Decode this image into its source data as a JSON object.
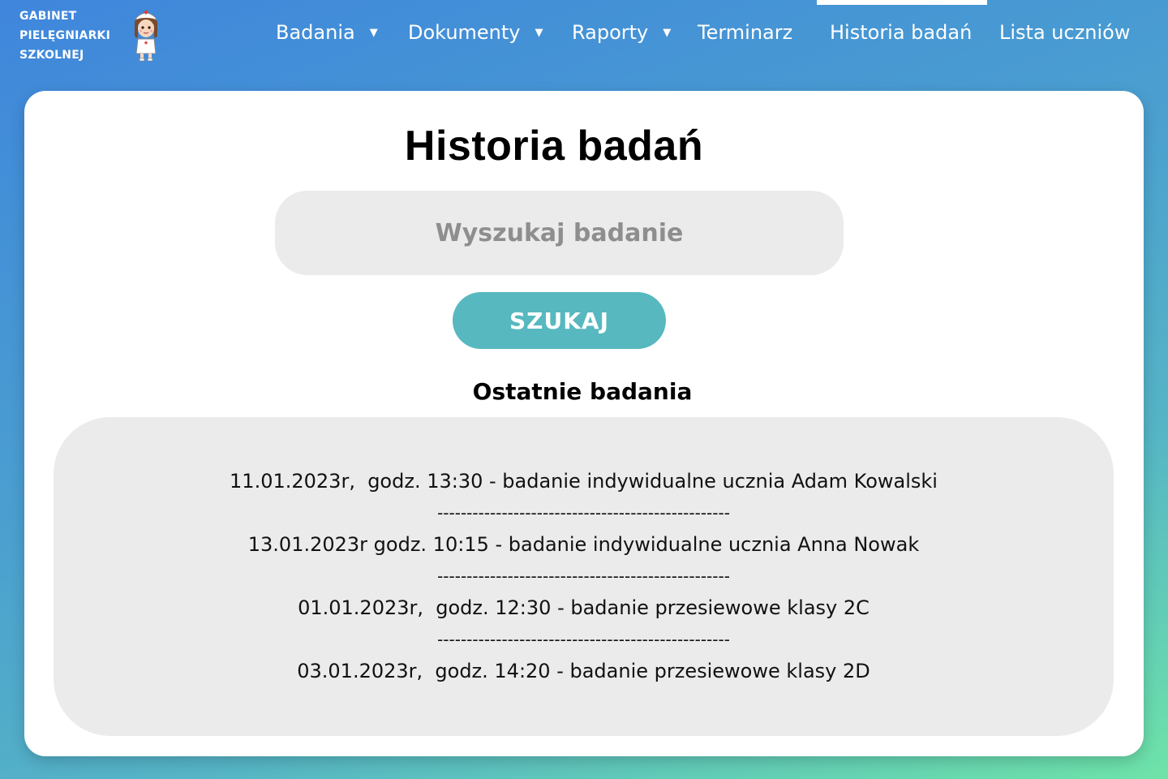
{
  "brand": {
    "lines": [
      "GABINET",
      "PIELĘGNIARKI",
      "SZKOLNEJ"
    ],
    "logo_icon": "nurse-mascot-icon"
  },
  "nav": {
    "items": [
      {
        "label": "Badania",
        "has_dropdown": true
      },
      {
        "label": "Dokumenty",
        "has_dropdown": true
      },
      {
        "label": "Raporty",
        "has_dropdown": true
      },
      {
        "label": "Terminarz",
        "has_dropdown": false
      },
      {
        "label": "Historia badań",
        "has_dropdown": false,
        "active": true
      },
      {
        "label": "Lista uczniów",
        "has_dropdown": false
      }
    ],
    "dropdown_icon": "▼"
  },
  "main": {
    "title": "Historia badań",
    "search": {
      "placeholder": "Wyszukaj badanie",
      "value": ""
    },
    "search_button": "SZUKAJ",
    "recent_title": "Ostatnie badania",
    "recent": [
      "11.01.2023r,  godz. 13:30 - badanie indywidualne ucznia Adam Kowalski",
      "13.01.2023r godz. 10:15 - badanie indywidualne ucznia Anna Nowak",
      "01.01.2023r,  godz. 12:30 - badanie przesiewowe klasy 2C",
      "03.01.2023r,  godz. 14:20 - badanie przesiewowe klasy 2D"
    ],
    "separator": "--------------------------------------------------"
  },
  "colors": {
    "accent": "#57b8c0",
    "gradient_start": "#3f86dc",
    "gradient_end": "#6ee3a8",
    "panel": "#ebebeb"
  }
}
